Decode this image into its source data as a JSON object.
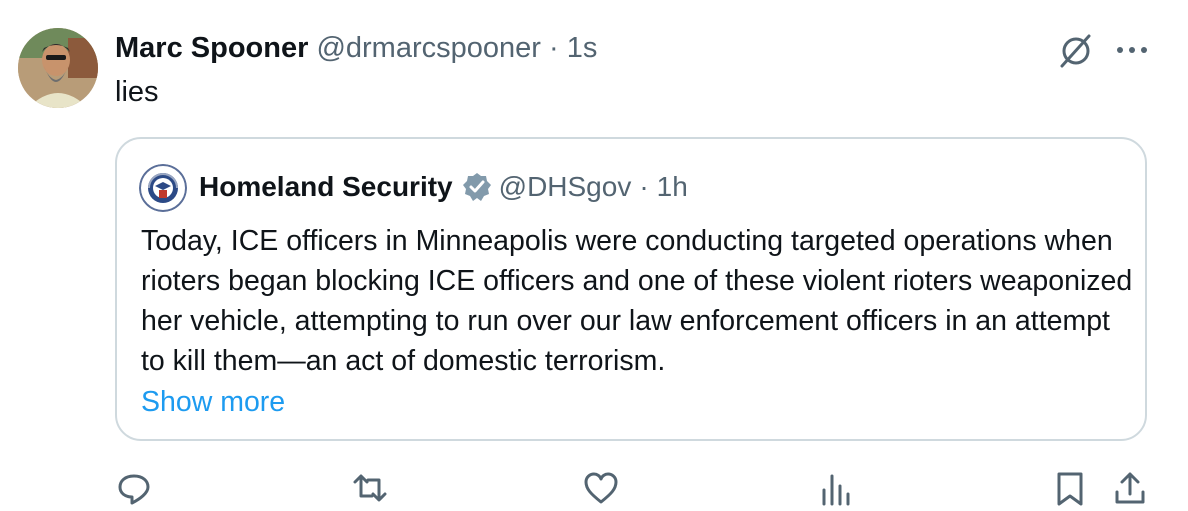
{
  "post": {
    "author_name": "Marc Spooner",
    "author_handle": "@drmarcspooner",
    "separator": "·",
    "timestamp": "1s",
    "text": "lies"
  },
  "quoted_post": {
    "author_name": "Homeland Security",
    "author_handle": "@DHSgov",
    "separator": "·",
    "timestamp": "1h",
    "verified": "gray-government-badge",
    "text": "Today, ICE officers in Minneapolis were conducting targeted operations when rioters began blocking ICE officers and one of these violent rioters weaponized her vehicle, attempting to run over our law enforcement officers in an attempt to kill them—an act of domestic terrorism.",
    "show_more": "Show more"
  },
  "icons": [
    "grok-icon",
    "more-icon",
    "reply-icon",
    "repost-icon",
    "like-icon",
    "views-icon",
    "bookmark-icon",
    "share-icon"
  ],
  "colors": {
    "text": "#0f1419",
    "secondary": "#536471",
    "link": "#1d9bf0",
    "border": "#cfd9de"
  }
}
